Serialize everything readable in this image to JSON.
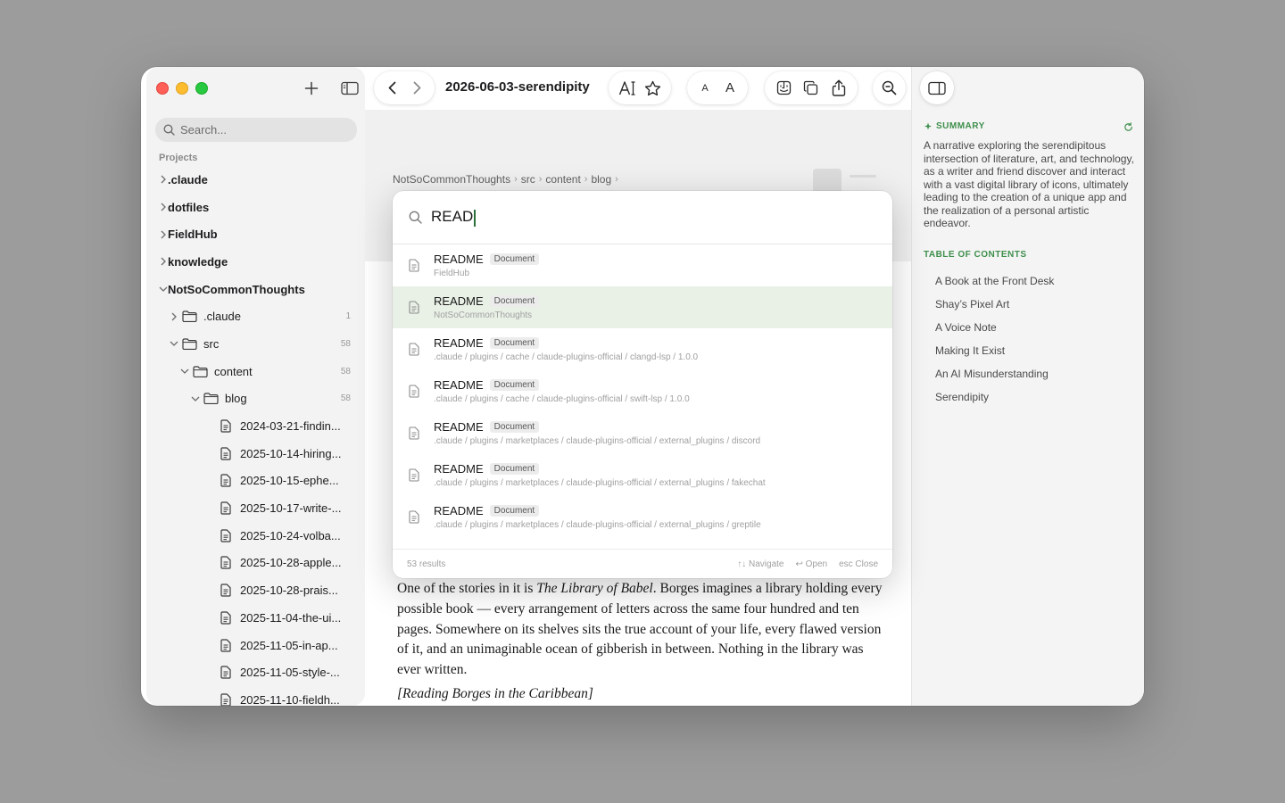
{
  "sidebar": {
    "search_placeholder": "Search...",
    "section_label": "Projects",
    "projects": [
      ".claude",
      "dotfiles",
      "FieldHub",
      "knowledge",
      "NotSoCommonThoughts"
    ],
    "tree": [
      {
        "label": ".claude",
        "count": "1"
      },
      {
        "label": "src",
        "count": "58"
      },
      {
        "label": "content",
        "count": "58"
      },
      {
        "label": "blog",
        "count": "58"
      }
    ],
    "files": [
      "2024-03-21-findin...",
      "2025-10-14-hiring...",
      "2025-10-15-ephe...",
      "2025-10-17-write-...",
      "2025-10-24-volba...",
      "2025-10-28-apple...",
      "2025-10-28-prais...",
      "2025-11-04-the-ui...",
      "2025-11-05-in-ap...",
      "2025-11-05-style-...",
      "2025-11-10-fieldh..."
    ]
  },
  "toolbar": {
    "doc_title": "2026-06-03-serendipity",
    "font_small": "A",
    "font_large": "A"
  },
  "breadcrumb": [
    "NotSoCommonThoughts",
    "src",
    "content",
    "blog"
  ],
  "palette": {
    "query": "READ",
    "results": [
      {
        "name": "README",
        "type": "Document",
        "path": "FieldHub"
      },
      {
        "name": "README",
        "type": "Document",
        "path": "NotSoCommonThoughts"
      },
      {
        "name": "README",
        "type": "Document",
        "path": ".claude / plugins / cache / claude-plugins-official / clangd-lsp / 1.0.0"
      },
      {
        "name": "README",
        "type": "Document",
        "path": ".claude / plugins / cache / claude-plugins-official / swift-lsp / 1.0.0"
      },
      {
        "name": "README",
        "type": "Document",
        "path": ".claude / plugins / marketplaces / claude-plugins-official / external_plugins / discord"
      },
      {
        "name": "README",
        "type": "Document",
        "path": ".claude / plugins / marketplaces / claude-plugins-official / external_plugins / fakechat"
      },
      {
        "name": "README",
        "type": "Document",
        "path": ".claude / plugins / marketplaces / claude-plugins-official / external_plugins / greptile"
      }
    ],
    "count_label": "53 results",
    "hint_navigate": "↑↓ Navigate",
    "hint_open": "↩ Open",
    "hint_close": "esc Close"
  },
  "article": {
    "p1_before": "One of the stories in it is ",
    "p1_title": "The Library of Babel",
    "p1_after": ". Borges imagines a library holding every possible book — every arrangement of letters across the same four hundred and ten pages. Somewhere on its shelves sits the true account of your life, every flawed version of it, and an unimaginable ocean of gibberish in between. Nothing in the library was ever written.",
    "caption": "[Reading Borges in the Caribbean]"
  },
  "right_panel": {
    "summary_label": "SUMMARY",
    "summary_text": "A narrative exploring the serendipitous intersection of literature, art, and technology, as a writer and friend discover and interact with a vast digital library of icons, ultimately leading to the creation of a unique app and the realization of a personal artistic endeavor.",
    "toc_label": "TABLE OF CONTENTS",
    "toc": [
      "A Book at the Front Desk",
      "Shay’s Pixel Art",
      "A Voice Note",
      "Making It Exist",
      "An AI Misunderstanding",
      "Serendipity"
    ]
  },
  "colors": {
    "accent_green": "#3e8f4c",
    "selected_row": "#e9f1e6"
  }
}
